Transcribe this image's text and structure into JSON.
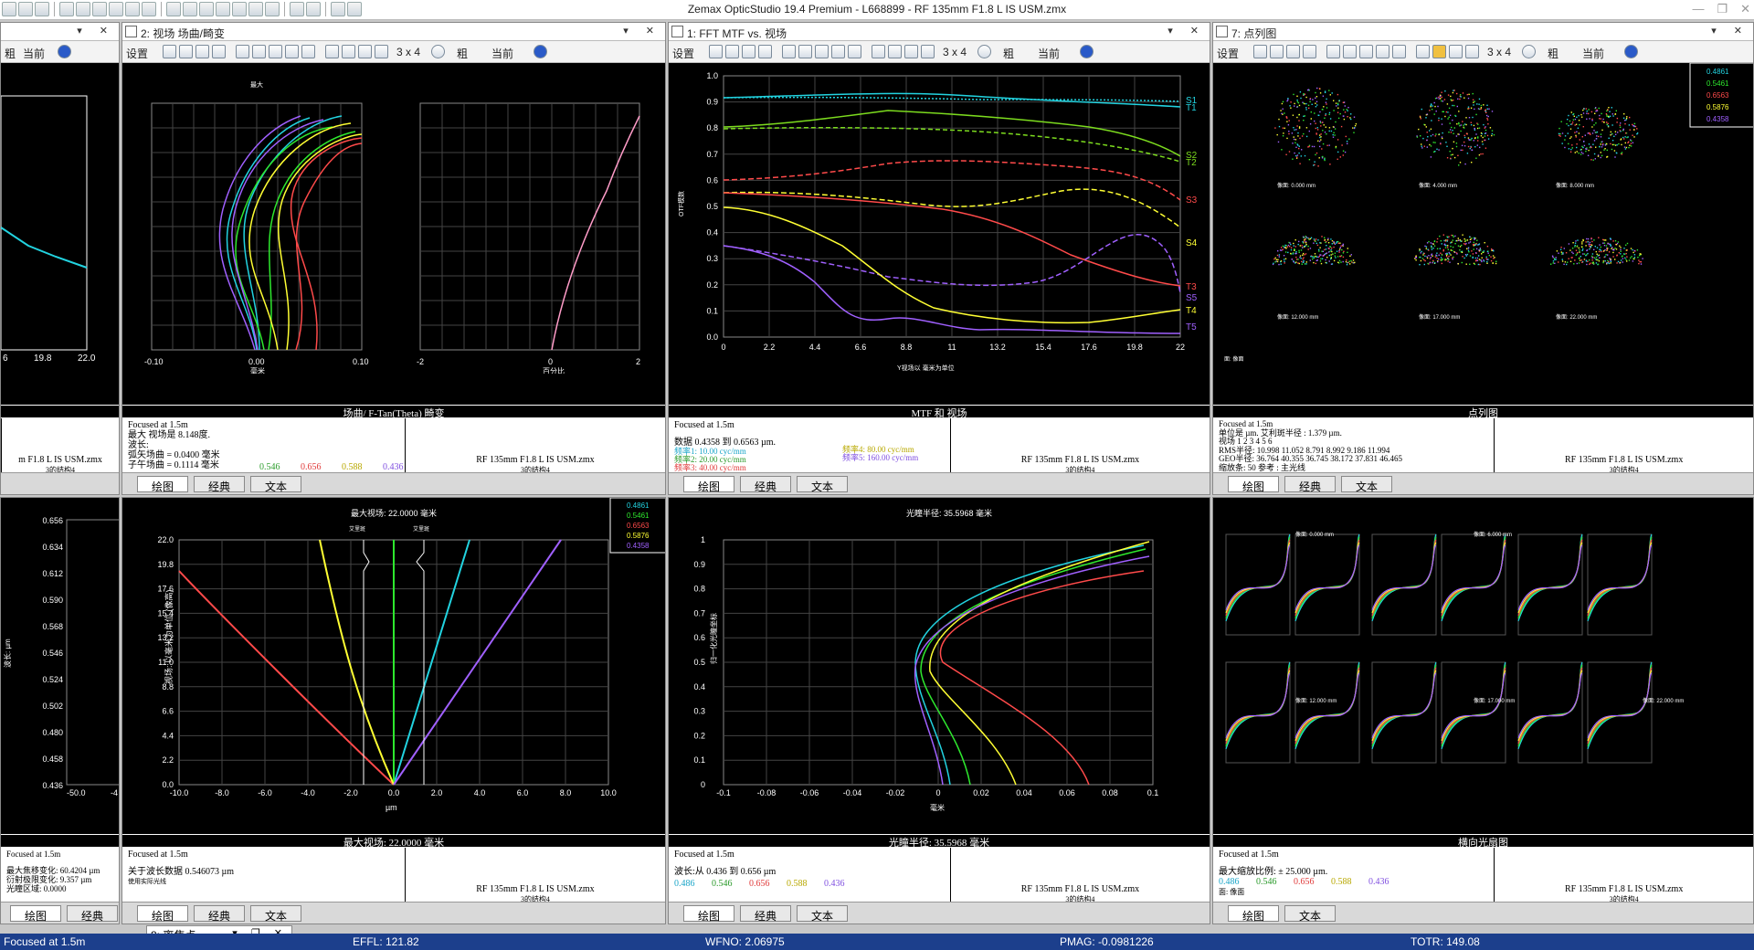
{
  "app": {
    "title": "Zemax OpticStudio 19.4    Premium - L668899 - RF 135mm F1.8 L IS USM.zmx",
    "window_controls": [
      "—",
      "❐",
      "✕"
    ]
  },
  "toolbar": {
    "settings": "设置",
    "grid": "3 x 4",
    "weight": "粗",
    "current": "当前"
  },
  "panes": {
    "left_top": {
      "title": "",
      "axis_ticks": [
        "6",
        "19.8",
        "22.0"
      ],
      "caption": "",
      "file": "m F1.8 L IS USM.zmx",
      "config": "3的结构4"
    },
    "field": {
      "title": "2: 视场 场曲/畸变",
      "caption": "场曲/ F-Tan(Theta) 畸变",
      "legend_top": "最大",
      "xticks_left": [
        "-0.10",
        "0.00",
        "0.10"
      ],
      "xticks_right": [
        "-2",
        "0",
        "2"
      ],
      "xlabel_left": "毫米",
      "xlabel_right": "百分比",
      "info": [
        "Focused at 1.5m",
        "最大 视场是 8.148度.",
        "波长:",
        "弧矢场曲 = 0.0400 毫米",
        "子午场曲 = 0.1114 毫米"
      ],
      "wavelengths": [
        "0.546",
        "0.656",
        "0.588",
        "0.436"
      ],
      "file": "RF 135mm F1.8 L IS USM.zmx",
      "config": "3的结构4"
    },
    "mtf": {
      "title": "1: FFT MTF vs. 视场",
      "caption": "MTF 和 视场",
      "yticks": [
        "1.0",
        "0.9",
        "0.8",
        "0.7",
        "0.6",
        "0.5",
        "0.4",
        "0.3",
        "0.2",
        "0.1",
        "0.0"
      ],
      "xticks": [
        "0",
        "2.2",
        "4.4",
        "6.6",
        "8.8",
        "11",
        "13.2",
        "15.4",
        "17.6",
        "19.8",
        "22"
      ],
      "ylabel": "OTF模数",
      "xlabel": "Y视场以 毫米为单位",
      "labels": [
        "S1",
        "T1",
        "S2",
        "T2",
        "S3",
        "S4",
        "T3",
        "S5",
        "T4",
        "T5"
      ],
      "info": [
        "Focused at 1.5m",
        "数据 0.4358 到 0.6563 µm.",
        "频率1:  10.00 cyc/mm",
        "频率2:  20.00 cyc/mm",
        "频率3:  40.00 cyc/mm",
        "频率4:  80.00 cyc/mm",
        "频率5:  160.00 cyc/mm"
      ],
      "file": "RF 135mm F1.8 L IS USM.zmx",
      "config": "3的结构4"
    },
    "spot": {
      "title": "7: 点列图",
      "caption": "点列图",
      "legend": [
        "0.4861",
        "0.5461",
        "0.6563",
        "0.5876",
        "0.4358"
      ],
      "field_labels": [
        "像面: 0.000 mm",
        "像面: 4.000 mm",
        "像面: 8.000 mm",
        "像面: 12.000 mm",
        "像面: 17.000 mm",
        "像面: 22.000 mm"
      ],
      "surface": "面: 像面",
      "info": [
        "Focused at 1.5m",
        "单位是 µm.          艾利斑半径 : 1.379 µm.",
        "视场       1       2       3       4       5       6",
        "RMS半径:  10.998   11.052   8.791   8.992   9.186   11.994",
        "GEO半径:  36.764   40.355   36.745   38.172   37.831   46.465",
        "缩放条:    50   参考  : 主光线"
      ],
      "file": "RF 135mm F1.8 L IS USM.zmx",
      "config": "3的结构4"
    },
    "left_bottom": {
      "yticks": [
        "0.656",
        "0.634",
        "0.612",
        "0.590",
        "0.568",
        "0.546",
        "0.524",
        "0.502",
        "0.480",
        "0.458",
        "0.436"
      ],
      "xticks": [
        "-50.0",
        "-4"
      ],
      "ylabel": "波长: µm",
      "info": [
        "Focused at 1.5m",
        "最大焦移变化: 60.4204 µm",
        "衍射极限变化: 9.357 µm",
        "光瞳区域: 0.0000"
      ]
    },
    "longitudinal": {
      "title": "最大视场: 22.0000 毫米",
      "caption": "最大视场: 22.0000 毫米",
      "legend": [
        "0.4861",
        "0.5461",
        "0.6563",
        "0.5876",
        "0.4358"
      ],
      "yticks": [
        "22.0",
        "19.8",
        "17.6",
        "15.4",
        "13.2",
        "11.0",
        "8.8",
        "6.6",
        "4.4",
        "2.2",
        "0.0"
      ],
      "xticks": [
        "-10.0",
        "-8.0",
        "-6.0",
        "-4.0",
        "-2.0",
        "0.0",
        "2.0",
        "4.0",
        "6.0",
        "8.0",
        "10.0"
      ],
      "xlabel": "µm",
      "ylabel": "视场: 以毫米为单位 (像高)",
      "marks": [
        "艾里斑",
        "艾里斑"
      ],
      "info": [
        "Focused at 1.5m",
        "关于波长数据 0.546073 µm",
        "使用实际光线"
      ],
      "file": "RF 135mm F1.8 L IS USM.zmx",
      "config": "3的结构4"
    },
    "lsa": {
      "title": "光瞳半径: 35.5968 毫米",
      "caption": "光瞳半径: 35.5968 毫米",
      "yticks": [
        "1",
        "0.9",
        "0.8",
        "0.7",
        "0.6",
        "0.5",
        "0.4",
        "0.3",
        "0.2",
        "0.1",
        "0"
      ],
      "xticks": [
        "-0.1",
        "-0.08",
        "-0.06",
        "-0.04",
        "-0.02",
        "0",
        "0.02",
        "0.04",
        "0.06",
        "0.08",
        "0.1"
      ],
      "xlabel": "毫米",
      "ylabel": "归一化光瞳坐标",
      "info": [
        "Focused at 1.5m",
        "波长:从 0.436 到 0.656 µm"
      ],
      "wavelengths": [
        "0.486",
        "0.546",
        "0.656",
        "0.588",
        "0.436"
      ],
      "file": "RF 135mm F1.8 L IS USM.zmx",
      "config": "3的结构4"
    },
    "ray_fan": {
      "caption": "横向光扇图",
      "field_labels": [
        "像面: 0.000 mm",
        "像面: 6.000 mm",
        "像面: 12.000 mm",
        "像面: 17.000 mm",
        "像面: 22.000 mm"
      ],
      "info": [
        "Focused at 1.5m",
        "最大缩放比例: ± 25.000 µm."
      ],
      "wavelengths": [
        "0.486",
        "0.546",
        "0.656",
        "0.588",
        "0.436"
      ],
      "surface": "面: 像面",
      "file": "RF 135mm F1.8 L IS USM.zmx",
      "config": "3的结构4"
    }
  },
  "tabs": {
    "plot": "绘图",
    "classic": "经典",
    "text": "文本"
  },
  "minimized": "8: 离焦点",
  "status": {
    "focus": "Focused at 1.5m",
    "effl": "EFFL: 121.82",
    "wfno": "WFNO: 2.06975",
    "pmag": "PMAG: -0.0981226",
    "totr": "TOTR: 149.08"
  },
  "colors": {
    "c486": "#22d3e0",
    "c546": "#2ee82e",
    "c656": "#ff4a4a",
    "c588": "#ffff33",
    "c436": "#a060ff"
  }
}
